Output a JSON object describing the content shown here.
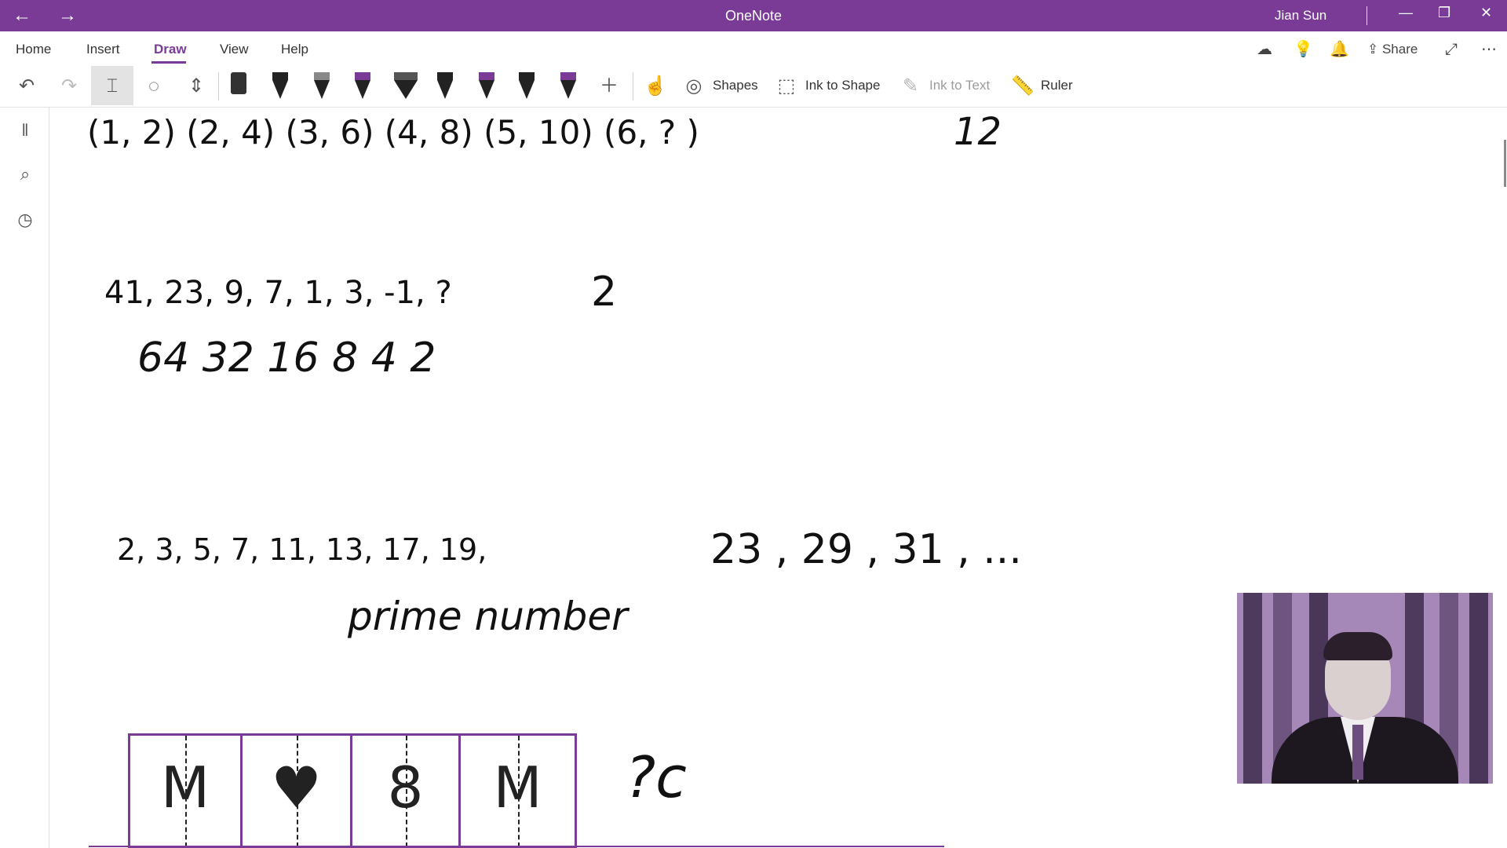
{
  "window": {
    "title": "OneNote",
    "user": "Jian Sun"
  },
  "title_bar": {
    "back_icon": "←",
    "forward_icon": "→",
    "minimize": "—",
    "restore": "❐",
    "close": "✕"
  },
  "ribbon": {
    "tabs": [
      "Home",
      "Insert",
      "Draw",
      "View",
      "Help"
    ],
    "active_tab": "Draw",
    "share_label": "Share"
  },
  "toolbar": {
    "shapes_label": "Shapes",
    "ink_to_shape_label": "Ink to Shape",
    "ink_to_text_label": "Ink to Text",
    "ruler_label": "Ruler",
    "pen_colors": [
      "#222222",
      "#222222",
      "#888888",
      "#7a3b96",
      "#555555",
      "#222222",
      "#7a3b96",
      "#222222",
      "#7a3b96"
    ]
  },
  "canvas": {
    "row1": "(1,  2)    (2,  4)    (3,  6)    (4,  8)    (5,  10)    (6,  ? )",
    "row1_answer": "12",
    "row2": "41,  23,  9,  7,  1,  3,  -1,  ?",
    "row2_answer": "2",
    "row2_diffs": "64  32  16  8  4  2",
    "row3_typed": "2,    3,    5,    7,    11,    13,    17,    19,",
    "row3_handwritten": "23 , 29 , 31 , ...",
    "row3_label": "prime number",
    "puzzle_symbols": [
      "M",
      "♥",
      "8",
      "M"
    ],
    "puzzle_question": "?c"
  },
  "colors": {
    "accent": "#7a3b96"
  }
}
